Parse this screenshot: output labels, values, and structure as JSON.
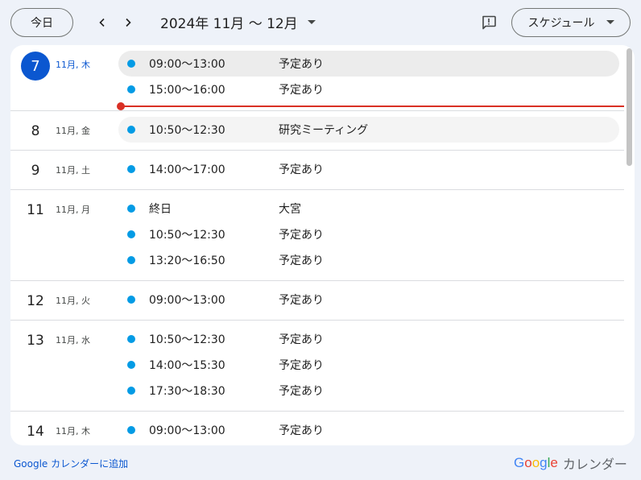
{
  "header": {
    "today_label": "今日",
    "date_range": "2024年 11月 〜 12月",
    "view_label": "スケジュール"
  },
  "days": [
    {
      "num": "7",
      "meta": "11月, 木",
      "today": true,
      "events": [
        {
          "time": "09:00〜13:00",
          "title": "予定あり",
          "highlight": "strong"
        },
        {
          "time": "15:00〜16:00",
          "title": "予定あり",
          "highlight": "none"
        }
      ],
      "now_indicator": true
    },
    {
      "num": "8",
      "meta": "11月, 金",
      "today": false,
      "events": [
        {
          "time": "10:50〜12:30",
          "title": "研究ミーティング",
          "highlight": "soft"
        }
      ]
    },
    {
      "num": "9",
      "meta": "11月, 土",
      "today": false,
      "events": [
        {
          "time": "14:00〜17:00",
          "title": "予定あり",
          "highlight": "none"
        }
      ]
    },
    {
      "num": "11",
      "meta": "11月, 月",
      "today": false,
      "events": [
        {
          "time": "終日",
          "title": "大宮",
          "highlight": "none"
        },
        {
          "time": "10:50〜12:30",
          "title": "予定あり",
          "highlight": "none"
        },
        {
          "time": "13:20〜16:50",
          "title": "予定あり",
          "highlight": "none"
        }
      ]
    },
    {
      "num": "12",
      "meta": "11月, 火",
      "today": false,
      "events": [
        {
          "time": "09:00〜13:00",
          "title": "予定あり",
          "highlight": "none"
        }
      ]
    },
    {
      "num": "13",
      "meta": "11月, 水",
      "today": false,
      "events": [
        {
          "time": "10:50〜12:30",
          "title": "予定あり",
          "highlight": "none"
        },
        {
          "time": "14:00〜15:30",
          "title": "予定あり",
          "highlight": "none"
        },
        {
          "time": "17:30〜18:30",
          "title": "予定あり",
          "highlight": "none"
        }
      ]
    },
    {
      "num": "14",
      "meta": "11月, 木",
      "today": false,
      "events": [
        {
          "time": "09:00〜13:00",
          "title": "予定あり",
          "highlight": "none"
        }
      ]
    }
  ],
  "footer": {
    "add_link": "Google カレンダーに追加",
    "brand_name": "カレンダー",
    "logo_letters": [
      {
        "ch": "G",
        "color": "#4285F4"
      },
      {
        "ch": "o",
        "color": "#EA4335"
      },
      {
        "ch": "o",
        "color": "#FBBC05"
      },
      {
        "ch": "g",
        "color": "#4285F4"
      },
      {
        "ch": "l",
        "color": "#34A853"
      },
      {
        "ch": "e",
        "color": "#EA4335"
      }
    ]
  },
  "colors": {
    "accent": "#0b57d0",
    "event_dot": "#039be5",
    "now_line": "#d93025"
  },
  "icons": {
    "prev": "chevron-left-icon",
    "next": "chevron-right-icon",
    "range_caret": "caret-down-icon",
    "feedback": "feedback-icon",
    "view_caret": "caret-down-icon"
  }
}
